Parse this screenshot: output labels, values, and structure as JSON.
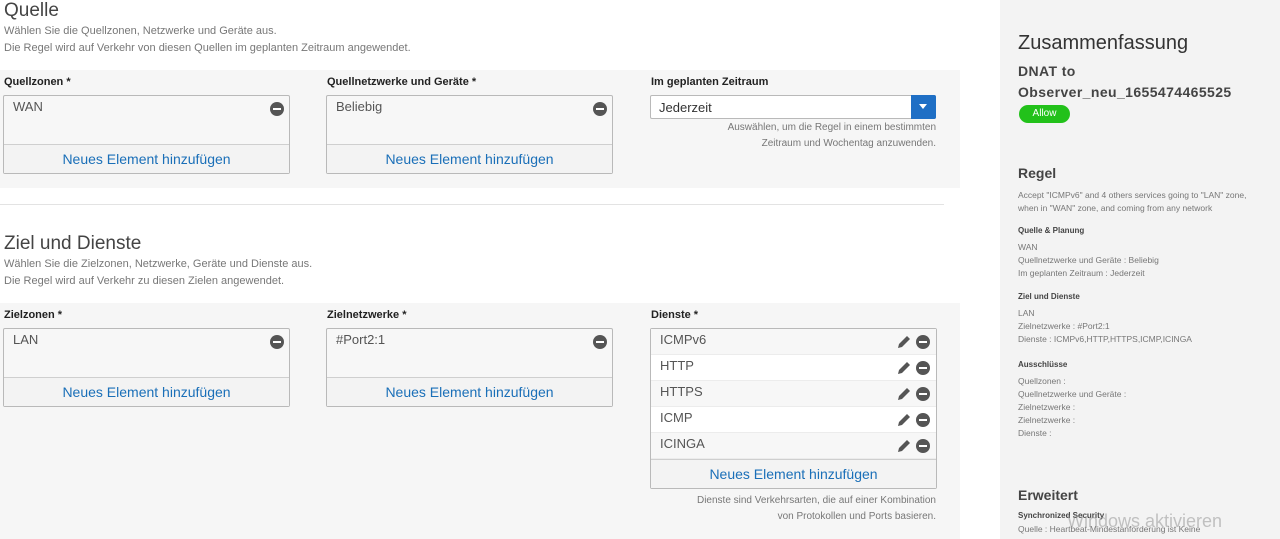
{
  "quelle": {
    "title": "Quelle",
    "desc1": "Wählen Sie die Quellzonen, Netzwerke und Geräte aus.",
    "desc2": "Die Regel wird auf Verkehr von diesen Quellen im geplanten Zeitraum angewendet.",
    "zones_label": "Quellzonen *",
    "zones": [
      "WAN"
    ],
    "networks_label": "Quellnetzwerke und Geräte *",
    "networks": [
      "Beliebig"
    ],
    "add_label": "Neues Element hinzufügen",
    "schedule_label": "Im geplanten Zeitraum",
    "schedule_value": "Jederzeit",
    "schedule_hint1": "Auswählen, um die Regel in einem bestimmten",
    "schedule_hint2": "Zeitraum und Wochentag anzuwenden."
  },
  "ziel": {
    "title": "Ziel und Dienste",
    "desc1": "Wählen Sie die Zielzonen, Netzwerke, Geräte und Dienste aus.",
    "desc2": "Die Regel wird auf Verkehr zu diesen Zielen angewendet.",
    "zones_label": "Zielzonen *",
    "zones": [
      "LAN"
    ],
    "networks_label": "Zielnetzwerke *",
    "networks": [
      "#Port2:1"
    ],
    "services_label": "Dienste *",
    "services": [
      "ICMPv6",
      "HTTP",
      "HTTPS",
      "ICMP",
      "ICINGA"
    ],
    "add_label": "Neues Element hinzufügen",
    "services_hint1": "Dienste sind Verkehrsarten, die auf einer Kombination",
    "services_hint2": "von Protokollen und Ports basieren."
  },
  "summary": {
    "title": "Zusammenfassung",
    "rule_name_line1": "DNAT to",
    "rule_name_line2": "Observer_neu_1655474465525",
    "action_badge": "Allow",
    "regel_title": "Regel",
    "regel_desc1": "Accept \"ICMPv6\" and 4 others services going to \"LAN\" zone,",
    "regel_desc2": "when in \"WAN\" zone, and coming from any network",
    "src_title": "Quelle & Planung",
    "src_lines": [
      "WAN",
      "Quellnetzwerke und Geräte : Beliebig",
      "Im geplanten Zeitraum : Jederzeit"
    ],
    "dst_title": "Ziel und Dienste",
    "dst_lines": [
      "LAN",
      "Zielnetzwerke : #Port2:1",
      "Dienste : ICMPv6,HTTP,HTTPS,ICMP,ICINGA"
    ],
    "excl_title": "Ausschlüsse",
    "excl_lines": [
      "Quellzonen :",
      "Quellnetzwerke und Geräte :",
      "Zielnetzwerke :",
      "Zielnetzwerke :",
      "Dienste :"
    ],
    "adv_title": "Erweitert",
    "sync_title": "Synchronized Security",
    "sync_line": "Quelle : Heartbeat-Mindestanforderung ist Keine"
  },
  "watermark": "Windows aktivieren",
  "colors": {
    "accent": "#1f6fc5",
    "link": "#1a6fb8",
    "allow": "#22c11a"
  }
}
